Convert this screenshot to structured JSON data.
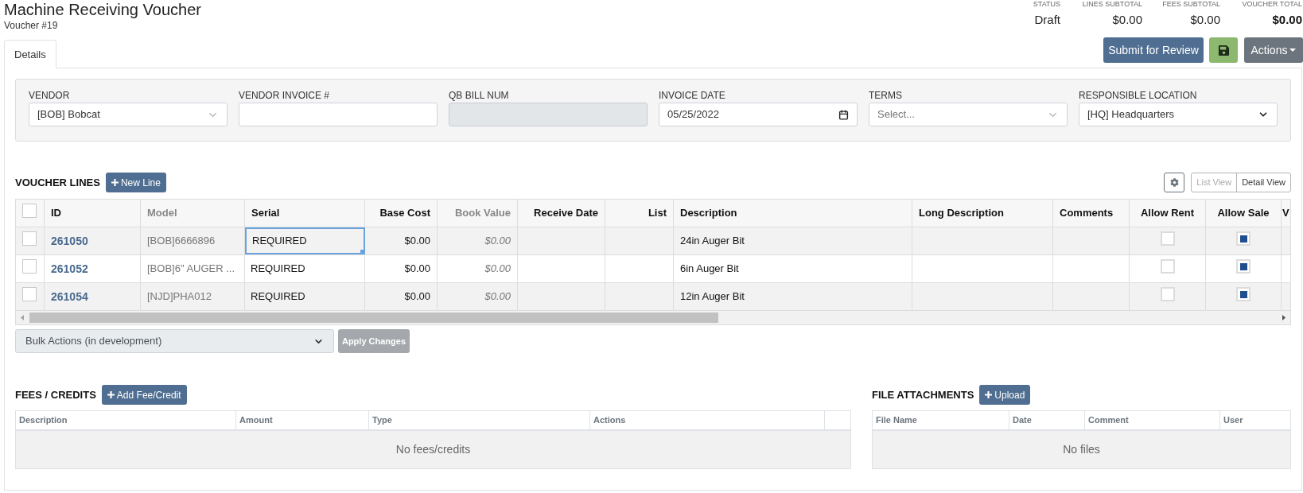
{
  "header": {
    "title": "Machine Receiving Voucher",
    "subtitle": "Voucher #19"
  },
  "summary": [
    {
      "label": "STATUS",
      "value": "Draft",
      "emphasis": false
    },
    {
      "label": "LINES SUBTOTAL",
      "value": "$0.00",
      "emphasis": false
    },
    {
      "label": "FEES SUBTOTAL",
      "value": "$0.00",
      "emphasis": false
    },
    {
      "label": "VOUCHER TOTAL",
      "value": "$0.00",
      "emphasis": true
    }
  ],
  "toolbar": [
    {
      "kind": "submit",
      "label": "Submit for Review"
    },
    {
      "kind": "save"
    },
    {
      "kind": "menu",
      "label": "Actions"
    }
  ],
  "tabs": [
    {
      "label": "Details",
      "selected": true
    }
  ],
  "form": {
    "fields": [
      {
        "kind": "combo",
        "label": "VENDOR",
        "value": "[BOB] Bobcat",
        "disabled": false
      },
      {
        "kind": "text",
        "label": "VENDOR INVOICE #",
        "disabled": false
      },
      {
        "kind": "text",
        "label": "QB BILL NUM",
        "disabled": true
      },
      {
        "kind": "date",
        "label": "INVOICE DATE",
        "value": "05/25/2022",
        "disabled": false
      },
      {
        "kind": "combo",
        "label": "TERMS",
        "placeholder": "Select...",
        "disabled": false
      },
      {
        "kind": "select",
        "label": "RESPONSIBLE LOCATION",
        "value": "[HQ] Headquarters",
        "disabled": false
      }
    ]
  },
  "voucher_lines": {
    "title": "VOUCHER LINES",
    "add_button": "New Line",
    "views": [
      {
        "label": "List View",
        "selected": false
      },
      {
        "label": "Detail View",
        "selected": true
      }
    ],
    "columns": [
      {
        "kind": "check",
        "checked": false
      },
      {
        "kind": "link",
        "label": "ID",
        "muted": false
      },
      {
        "kind": "text",
        "label": "Model",
        "muted": true
      },
      {
        "kind": "text",
        "label": "Serial",
        "muted": false
      },
      {
        "kind": "money",
        "label": "Base Cost",
        "muted": false
      },
      {
        "kind": "money",
        "label": "Book Value",
        "muted": true
      },
      {
        "kind": "date",
        "label": "Receive Date",
        "muted": false
      },
      {
        "kind": "number",
        "label": "List",
        "muted": false
      },
      {
        "kind": "text",
        "label": "Description",
        "muted": false
      },
      {
        "kind": "text",
        "label": "Long Description",
        "muted": false
      },
      {
        "kind": "text",
        "label": "Comments",
        "muted": false
      },
      {
        "kind": "flag",
        "label": "Allow Rent",
        "muted": false
      },
      {
        "kind": "flag",
        "label": "Allow Sale",
        "muted": false
      },
      {
        "kind": "cut",
        "label": "V",
        "muted": false
      }
    ],
    "rows": [
      {
        "checked": false,
        "id": "261050",
        "model": "[BOB]6666896",
        "serial": {
          "value": "REQUIRED",
          "focused": true
        },
        "base_cost": "$0.00",
        "book_value": "$0.00",
        "description": "24in Auger Bit",
        "allow_rent": false,
        "allow_sale": true
      },
      {
        "checked": false,
        "id": "261052",
        "model": "[BOB]6\" AUGER ...",
        "serial": {
          "value": "REQUIRED",
          "focused": false
        },
        "base_cost": "$0.00",
        "book_value": "$0.00",
        "description": "6in Auger Bit",
        "allow_rent": false,
        "allow_sale": true
      },
      {
        "checked": false,
        "id": "261054",
        "model": "[NJD]PHA012",
        "serial": {
          "value": "REQUIRED",
          "focused": false
        },
        "base_cost": "$0.00",
        "book_value": "$0.00",
        "description": "12in Auger Bit",
        "allow_rent": false,
        "allow_sale": true
      }
    ],
    "bulk_actions": {
      "value": "Bulk Actions (in development)"
    },
    "apply_button": {
      "label": "Apply Changes",
      "disabled": true
    }
  },
  "fees": {
    "title": "FEES / CREDITS",
    "add_button": "Add Fee/Credit",
    "columns": [
      "Description",
      "Amount",
      "Type",
      "Actions"
    ],
    "empty_message": "No fees/credits"
  },
  "files": {
    "title": "FILE ATTACHMENTS",
    "add_button": "Upload",
    "columns": [
      "File Name",
      "Date",
      "Comment",
      "User"
    ],
    "empty_message": "No files"
  }
}
